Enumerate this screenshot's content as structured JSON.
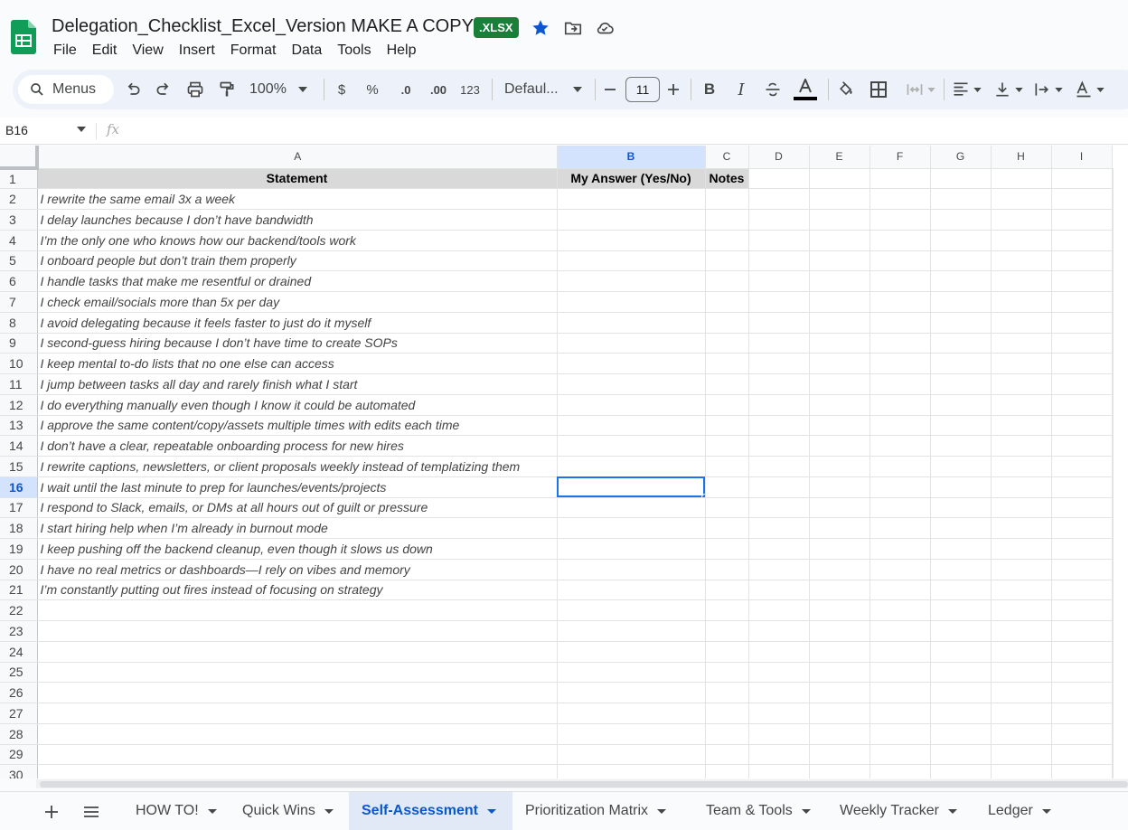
{
  "doc": {
    "title": "Delegation_Checklist_Excel_Version MAKE A COPY!",
    "format_badge": ".XLSX"
  },
  "menu": [
    "File",
    "Edit",
    "View",
    "Insert",
    "Format",
    "Data",
    "Tools",
    "Help"
  ],
  "toolbar": {
    "menus_label": "Menus",
    "zoom": "100%",
    "currency": "$",
    "percent": "%",
    "dec_decrease": ".0",
    "dec_increase": ".00",
    "number_format": "123",
    "font_name": "Defaul...",
    "font_size": "11"
  },
  "formula_bar": {
    "cell_ref": "B16",
    "fx": "fx",
    "value": ""
  },
  "columns": [
    "A",
    "B",
    "C",
    "D",
    "E",
    "F",
    "G",
    "H",
    "I"
  ],
  "selected_column": "B",
  "selected_row": 16,
  "header_row": {
    "a": "Statement",
    "b": "My Answer (Yes/No)",
    "c": "Notes"
  },
  "statements": [
    "I rewrite the same email 3x a week",
    "I delay launches because I don’t have bandwidth",
    "I’m the only one who knows how our backend/tools work",
    "I onboard people but don’t train them properly",
    "I handle tasks that make me resentful or drained",
    "I check email/socials more than 5x per day",
    "I avoid delegating because it feels faster to just do it myself",
    "I second-guess hiring because I don’t have time to create SOPs",
    "I keep mental to-do lists that no one else can access",
    "I jump between tasks all day and rarely finish what I start",
    "I do everything manually even though I know it could be automated",
    "I approve the same content/copy/assets multiple times with edits each time",
    "I don’t have a clear, repeatable onboarding process for new hires",
    "I rewrite captions, newsletters, or client proposals weekly instead of templatizing them",
    "I wait until the last minute to prep for launches/events/projects",
    "I respond to Slack, emails, or DMs at all hours out of guilt or pressure",
    "I start hiring help when I’m already in burnout mode",
    "I keep pushing off the backend cleanup, even though it slows us down",
    "I have no real metrics or dashboards—I rely on vibes and memory",
    "I’m constantly putting out fires instead of focusing on strategy"
  ],
  "row_numbers": [
    "1",
    "2",
    "3",
    "4",
    "5",
    "6",
    "7",
    "8",
    "9",
    "10",
    "11",
    "12",
    "13",
    "14",
    "15",
    "16",
    "17",
    "18",
    "19",
    "20",
    "21",
    "22",
    "23",
    "24",
    "25",
    "26",
    "27",
    "28",
    "29",
    "30"
  ],
  "tabs": [
    {
      "label": "HOW TO!",
      "active": false
    },
    {
      "label": "Quick Wins",
      "active": false
    },
    {
      "label": "Self-Assessment",
      "active": true
    },
    {
      "label": "Prioritization Matrix",
      "active": false
    },
    {
      "label": "Team & Tools",
      "active": false
    },
    {
      "label": "Weekly Tracker",
      "active": false
    },
    {
      "label": "Ledger",
      "active": false
    }
  ],
  "colors": {
    "accent": "#0b57d0",
    "sheets_green": "#0f9d58",
    "xlsx_badge": "#188038",
    "header_fill": "#d9d9d9",
    "selection": "#1a73e8"
  },
  "icons": [
    "search-icon",
    "undo-icon",
    "redo-icon",
    "print-icon",
    "paint-format-icon",
    "minus-icon",
    "plus-icon",
    "bold-icon",
    "italic-icon",
    "strikethrough-icon",
    "text-color-icon",
    "fill-color-icon",
    "borders-icon",
    "merge-icon",
    "align-icon",
    "valign-icon",
    "wrap-icon",
    "rotate-icon",
    "star-icon",
    "move-icon",
    "cloud-icon",
    "add-sheet-icon",
    "all-sheets-icon"
  ]
}
